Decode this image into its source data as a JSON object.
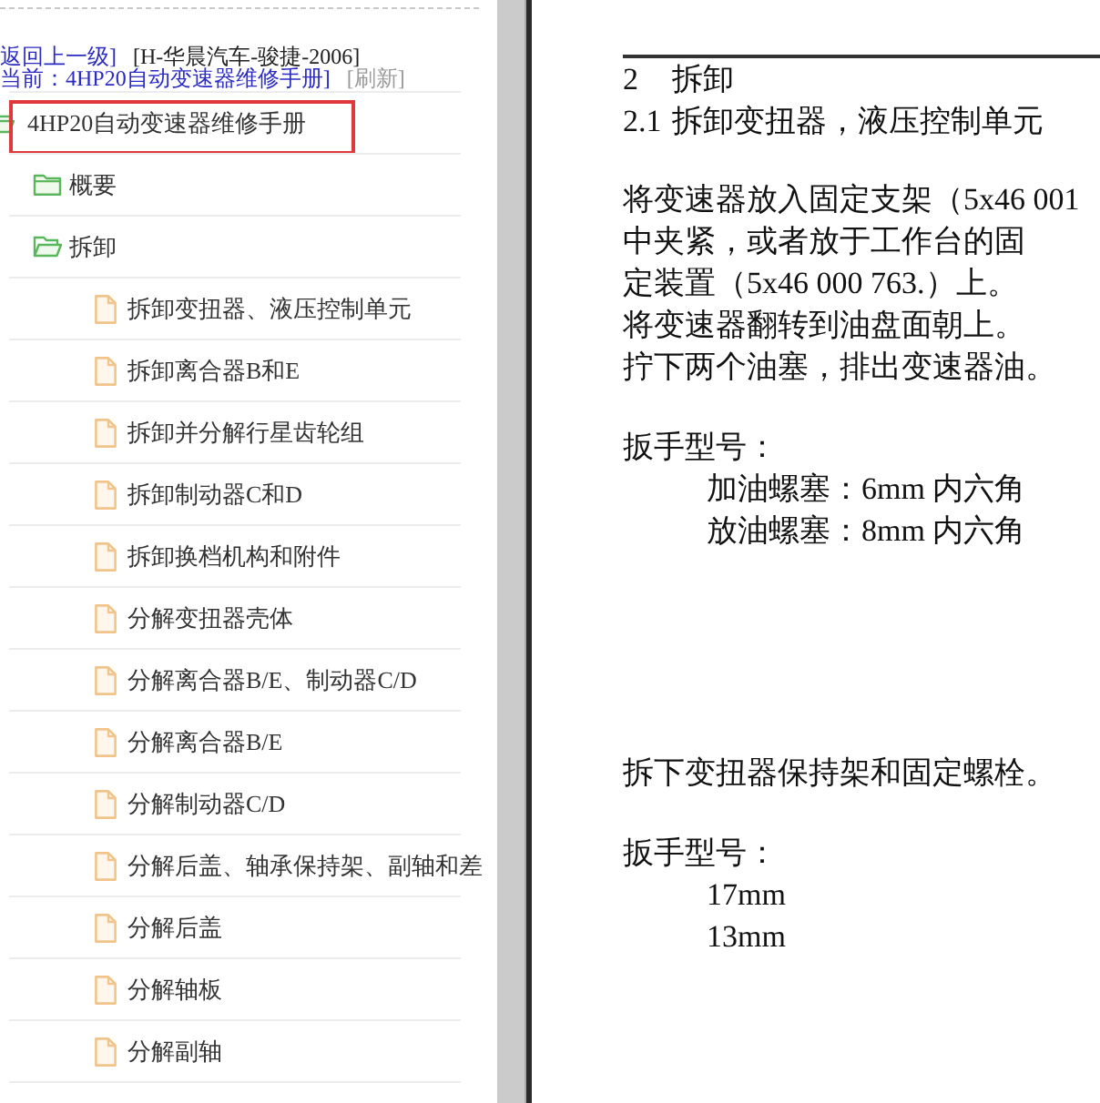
{
  "nav": {
    "back_link": "返回上一级]",
    "location": "[H-华晨汽车-骏捷-2006]",
    "current": "当前：4HP20自动变速器维修手册]",
    "refresh_link": "[刷新]"
  },
  "tree": [
    {
      "label": "4HP20自动变速器维修手册",
      "kind": "folder",
      "expanded": true,
      "highlighted": true,
      "children": [
        {
          "label": "概要",
          "kind": "folder",
          "expanded": false,
          "highlighted": false
        },
        {
          "label": "拆卸",
          "kind": "folder",
          "expanded": true,
          "highlighted": false,
          "children": [
            {
              "label": "拆卸变扭器、液压控制单元",
              "kind": "file",
              "highlighted": false
            },
            {
              "label": "拆卸离合器B和E",
              "kind": "file",
              "highlighted": false
            },
            {
              "label": "拆卸并分解行星齿轮组",
              "kind": "file",
              "highlighted": false
            },
            {
              "label": "拆卸制动器C和D",
              "kind": "file",
              "highlighted": false
            },
            {
              "label": "拆卸换档机构和附件",
              "kind": "file",
              "highlighted": false
            },
            {
              "label": "分解变扭器壳体",
              "kind": "file",
              "highlighted": false
            },
            {
              "label": "分解离合器B/E、制动器C/D",
              "kind": "file",
              "highlighted": false
            },
            {
              "label": "分解离合器B/E",
              "kind": "file",
              "highlighted": false
            },
            {
              "label": "分解制动器C/D",
              "kind": "file",
              "highlighted": false
            },
            {
              "label": "分解后盖、轴承保持架、副轴和差",
              "kind": "file",
              "highlighted": false
            },
            {
              "label": "分解后盖",
              "kind": "file",
              "highlighted": false
            },
            {
              "label": "分解轴板",
              "kind": "file",
              "highlighted": false
            },
            {
              "label": "分解副轴",
              "kind": "file",
              "highlighted": false
            }
          ]
        }
      ]
    }
  ],
  "document": {
    "headings": [
      {
        "number": "2",
        "title": "拆卸"
      },
      {
        "number": "2.1",
        "title": "拆卸变扭器，液压控制单元"
      }
    ],
    "blocks": [
      {
        "kind": "paragraph",
        "lines": [
          "将变速器放入固定支架（5x46 001",
          "中夹紧，或者放于工作台的固",
          "定装置（5x46 000 763.）上。",
          "将变速器翻转到油盘面朝上。",
          "拧下两个油塞，排出变速器油。"
        ]
      },
      {
        "kind": "spec",
        "title": "扳手型号：",
        "items": [
          "加油螺塞：6mm 内六角",
          "放油螺塞：8mm 内六角"
        ]
      },
      {
        "kind": "paragraph",
        "lines": [
          "拆下变扭器保持架和固定螺栓。"
        ]
      },
      {
        "kind": "spec",
        "title": "扳手型号：",
        "items": [
          "17mm",
          "13mm"
        ]
      }
    ]
  }
}
